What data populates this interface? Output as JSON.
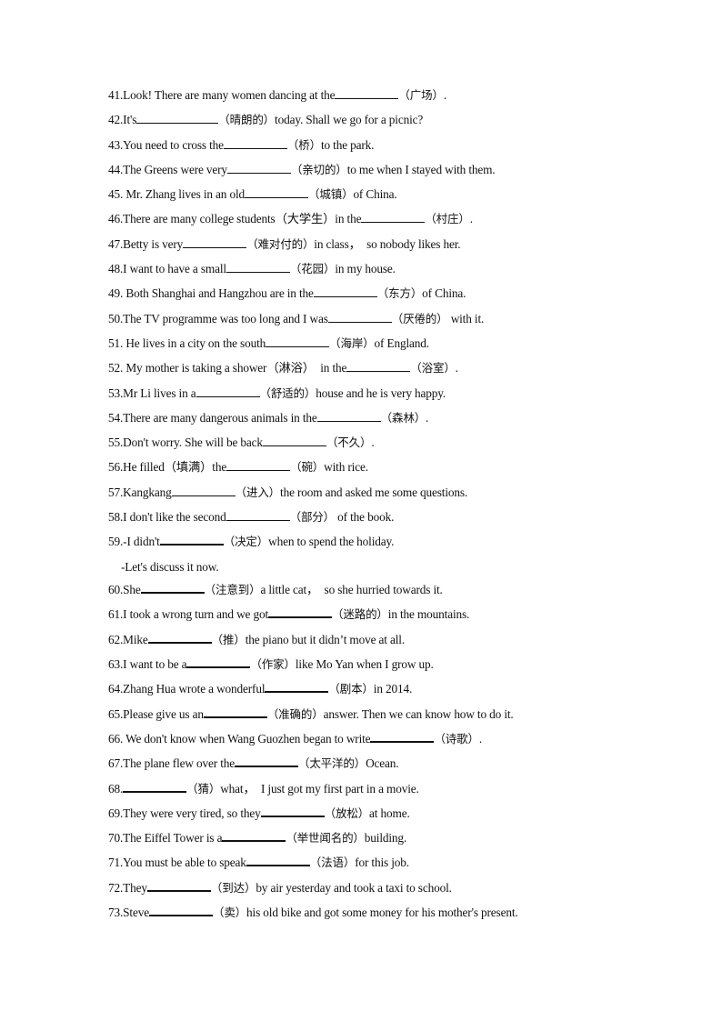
{
  "items": [
    {
      "num": "41.",
      "pre": "Look! There are many women dancing at the",
      "hint": "（广场）",
      "post": ".",
      "blank": "normal"
    },
    {
      "num": "42.",
      "pre": "It's",
      "hint": "（晴朗的）",
      "post": "today. Shall we go for a picnic?",
      "blank": "wide"
    },
    {
      "num": "43.",
      "pre": "You need to cross the",
      "hint": "（桥）",
      "post": "to the park.",
      "blank": "normal"
    },
    {
      "num": "44.",
      "pre": "The Greens were very",
      "hint": "（亲切的）",
      "post": "to me when I stayed with them.",
      "blank": "normal"
    },
    {
      "num": "45.",
      "pre": " Mr. Zhang lives in an old",
      "hint": "（城镇）",
      "post": "of China.",
      "blank": "normal"
    },
    {
      "num": "46.",
      "pre": "There are many college students（大学生）in the",
      "hint": "（村庄）",
      "post": ".",
      "blank": "normal"
    },
    {
      "num": "47.",
      "pre": "Betty is very",
      "hint": "（难对付的）",
      "post": "in class，  so nobody likes her.",
      "blank": "normal"
    },
    {
      "num": "48.",
      "pre": "I want to have a small",
      "hint": "（花园）",
      "post": "in my house.",
      "blank": "normal"
    },
    {
      "num": "49.",
      "pre": " Both Shanghai and Hangzhou are in the",
      "hint": "（东方）",
      "post": "of China.",
      "blank": "normal"
    },
    {
      "num": "50.",
      "pre": "The TV programme was too long and I was",
      "hint": "（厌倦的）",
      "post": " with it.",
      "blank": "normal"
    },
    {
      "num": "51.",
      "pre": " He lives in a city on the south",
      "hint": "（海岸）",
      "post": "of England.",
      "blank": "normal"
    },
    {
      "num": "52.",
      "pre": " My mother is taking a shower（淋浴）  in the",
      "hint": "（浴室）",
      "post": ".",
      "blank": "normal"
    },
    {
      "num": "53.",
      "pre": "Mr Li lives in a",
      "hint": "（舒适的）",
      "post": "house and he is very happy.",
      "blank": "normal"
    },
    {
      "num": "54.",
      "pre": "There are many dangerous animals in the",
      "hint": "（森林）",
      "post": ".",
      "blank": "normal"
    },
    {
      "num": "55.",
      "pre": "Don't worry. She will be back",
      "hint": "（不久）",
      "post": ".",
      "blank": "normal"
    },
    {
      "num": "56.",
      "pre": "He filled（填满）the",
      "hint": "（碗）",
      "post": "with rice.",
      "blank": "normal"
    },
    {
      "num": "57.",
      "pre": "Kangkang",
      "hint": "（进入）",
      "post": "the room and asked me some questions.",
      "blank": "normal"
    },
    {
      "num": "58.",
      "pre": "I don't like the second",
      "hint": "（部分）",
      "post": " of the book.",
      "blank": "normal"
    },
    {
      "num": "59.",
      "pre": "-I didn't",
      "hint": "（决定）",
      "post": "when to spend the holiday.",
      "blank": "bold"
    },
    {
      "continuation": "-Let's discuss it now."
    },
    {
      "num": "60.",
      "pre": "She",
      "hint": "（注意到）",
      "post": "a little cat，  so she hurried towards it.",
      "blank": "bold"
    },
    {
      "num": "61.",
      "pre": "I took a wrong turn and we got",
      "hint": "（迷路的）",
      "post": "in the mountains.",
      "blank": "bold"
    },
    {
      "num": "62.",
      "pre": "Mike",
      "hint": "（推）",
      "post": "the piano but it didn’t move at all.",
      "blank": "bold"
    },
    {
      "num": "63.",
      "pre": "I want to be a",
      "hint": "（作家）",
      "post": "like Mo Yan when I grow up.",
      "blank": "bold"
    },
    {
      "num": "64.",
      "pre": "Zhang Hua wrote a wonderful",
      "hint": "（剧本）",
      "post": "in 2014.",
      "blank": "bold"
    },
    {
      "num": "65.",
      "pre": "Please give us an",
      "hint": "（准确的）",
      "post": "answer. Then we can know how to do it.",
      "blank": "bold"
    },
    {
      "num": "66.",
      "pre": " We don't know when Wang Guozhen began to write",
      "hint": "（诗歌）",
      "post": ".",
      "blank": "bold"
    },
    {
      "num": "67.",
      "pre": "The plane flew over the",
      "hint": "（太平洋的）",
      "post": "Ocean.",
      "blank": "bold"
    },
    {
      "num": "68.",
      "pre": "",
      "hint": "（猜）",
      "post": "what，  I just got my first part in a movie.",
      "blank": "bold"
    },
    {
      "num": "69.",
      "pre": "They were very tired, so they",
      "hint": "（放松）",
      "post": "at home.",
      "blank": "bold"
    },
    {
      "num": "70.",
      "pre": "The Eiffel Tower is a",
      "hint": "（举世闻名的）",
      "post": "building.",
      "blank": "bold"
    },
    {
      "num": "71.",
      "pre": "You must be able to speak",
      "hint": "（法语）",
      "post": "for this job.",
      "blank": "bold"
    },
    {
      "num": "72.",
      "pre": "They",
      "hint": "（到达）",
      "post": "by air yesterday and took a taxi to school.",
      "blank": "bold"
    },
    {
      "num": "73.",
      "pre": "Steve",
      "hint": "（卖）",
      "post": "his old bike and got some money for his mother's present.",
      "blank": "bold"
    }
  ]
}
